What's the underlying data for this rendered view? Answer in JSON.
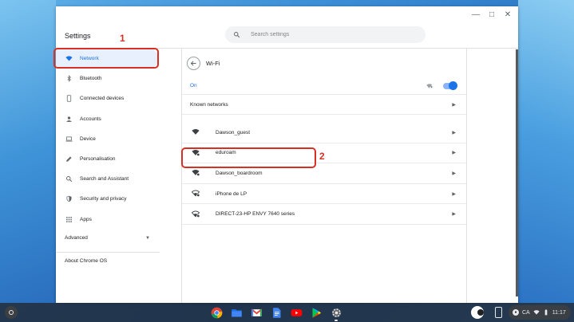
{
  "window": {
    "app_title": "Settings",
    "search_placeholder": "Search settings"
  },
  "sidebar": {
    "items": [
      {
        "label": "Network",
        "icon": "wifi-icon"
      },
      {
        "label": "Bluetooth",
        "icon": "bluetooth-icon"
      },
      {
        "label": "Connected devices",
        "icon": "phone-icon"
      },
      {
        "label": "Accounts",
        "icon": "person-icon"
      },
      {
        "label": "Device",
        "icon": "laptop-icon"
      },
      {
        "label": "Personalisation",
        "icon": "pencil-icon"
      },
      {
        "label": "Search and Assistant",
        "icon": "search-icon"
      },
      {
        "label": "Security and privacy",
        "icon": "shield-icon"
      },
      {
        "label": "Apps",
        "icon": "apps-grid-icon"
      }
    ],
    "advanced_label": "Advanced",
    "about_label": "About Chrome OS"
  },
  "wifi": {
    "title": "Wi-Fi",
    "on_label": "On",
    "known_networks_label": "Known networks",
    "networks": [
      {
        "name": "Dawson_guest",
        "secure": false
      },
      {
        "name": "eduroam",
        "secure": true
      },
      {
        "name": "Dawson_boardroom",
        "secure": true
      },
      {
        "name": "iPhone de LP",
        "secure": true
      },
      {
        "name": "DIRECT-23-HP ENVY 7640 series",
        "secure": true
      }
    ]
  },
  "annotations": {
    "one": "1",
    "two": "2"
  },
  "shelf": {
    "apps": [
      "chrome-icon",
      "files-icon",
      "gmail-icon",
      "docs-icon",
      "youtube-icon",
      "play-store-icon",
      "settings-gear-icon"
    ],
    "tray": {
      "input_method": "CA",
      "time": "11:17"
    }
  },
  "colors": {
    "accent": "#1a73e8",
    "annotation": "#d93025",
    "active_nav_bg": "#e8f0fe"
  }
}
